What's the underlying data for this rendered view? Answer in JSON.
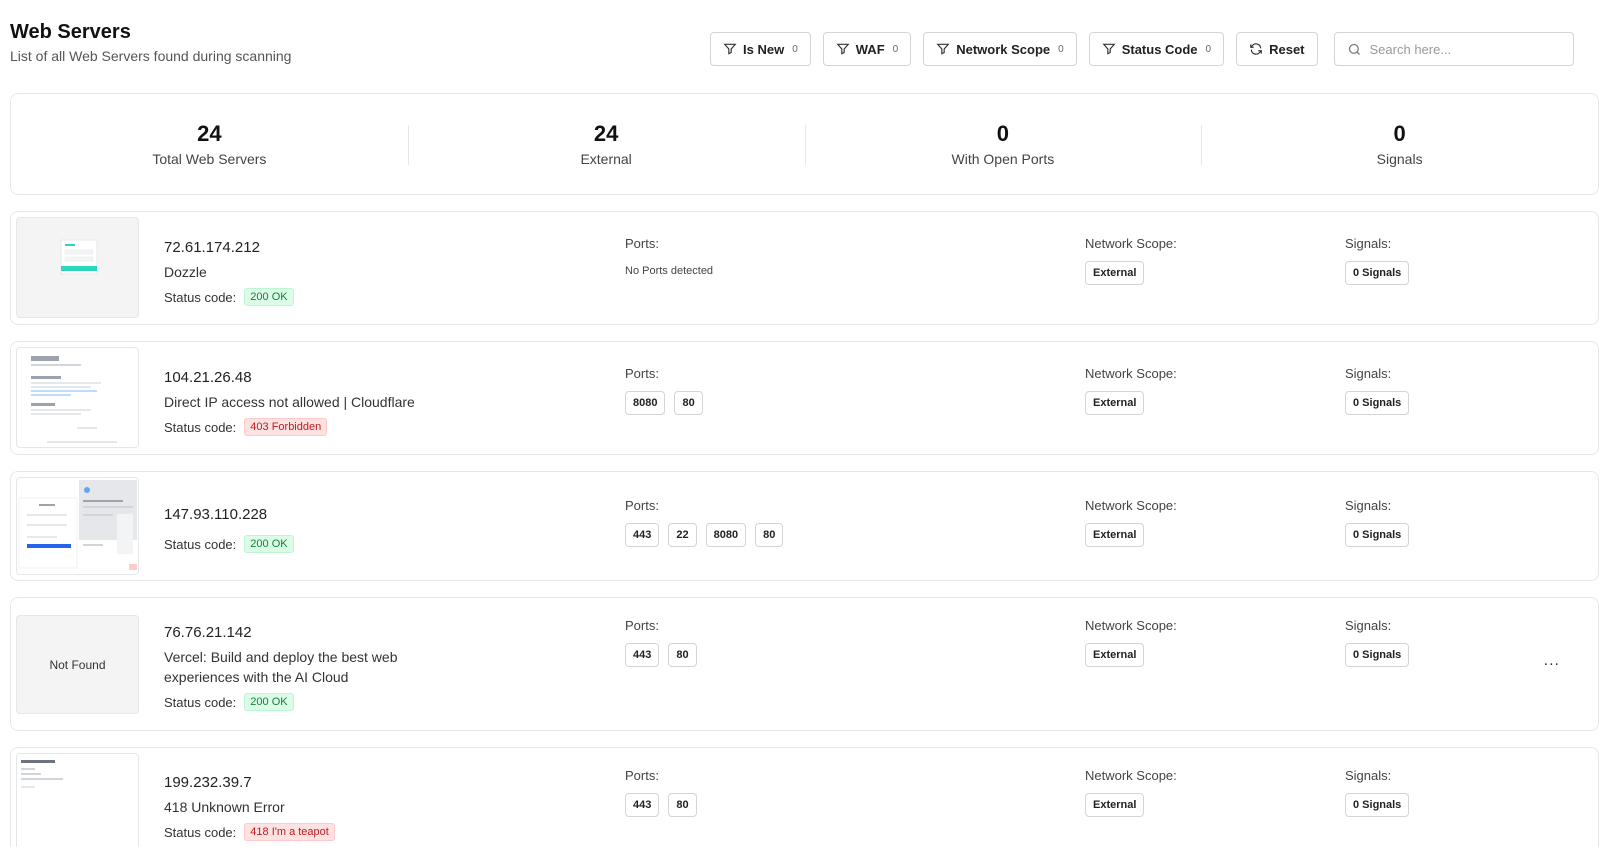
{
  "header": {
    "title": "Web Servers",
    "subtitle": "List of all Web Servers found during scanning"
  },
  "toolbar": {
    "filters": [
      {
        "label": "Is New",
        "count": "0"
      },
      {
        "label": "WAF",
        "count": "0"
      },
      {
        "label": "Network Scope",
        "count": "0"
      },
      {
        "label": "Status Code",
        "count": "0"
      }
    ],
    "reset_label": "Reset",
    "search_placeholder": "Search here..."
  },
  "stats": [
    {
      "value": "24",
      "label": "Total Web Servers"
    },
    {
      "value": "24",
      "label": "External"
    },
    {
      "value": "0",
      "label": "With Open Ports"
    },
    {
      "value": "0",
      "label": "Signals"
    }
  ],
  "labels": {
    "status_code": "Status code:",
    "ports": "Ports:",
    "network_scope": "Network Scope:",
    "signals": "Signals:",
    "more": "..."
  },
  "servers": [
    {
      "ip": "72.61.174.212",
      "name": "Dozzle",
      "status": "200 OK",
      "status_kind": "ok",
      "ports": [],
      "no_ports_text": "No Ports detected",
      "scope": "External",
      "signals": "0 Signals",
      "thumbnail": "login-page"
    },
    {
      "ip": "104.21.26.48",
      "name": "Direct IP access not allowed | Cloudflare",
      "status": "403 Forbidden",
      "status_kind": "err",
      "ports": [
        "8080",
        "80"
      ],
      "scope": "External",
      "signals": "0 Signals",
      "thumbnail": "error-page"
    },
    {
      "ip": "147.93.110.228",
      "name": "",
      "status": "200 OK",
      "status_kind": "ok",
      "ports": [
        "443",
        "22",
        "8080",
        "80"
      ],
      "scope": "External",
      "signals": "0 Signals",
      "thumbnail": "dashboard-page"
    },
    {
      "ip": "76.76.21.142",
      "name": "Vercel: Build and deploy the best web experiences with the AI Cloud",
      "status": "200 OK",
      "status_kind": "ok",
      "ports": [
        "443",
        "80"
      ],
      "scope": "External",
      "signals": "0 Signals",
      "thumbnail_text": "Not Found"
    },
    {
      "ip": "199.232.39.7",
      "name": "418 Unknown Error",
      "status": "418 I'm a teapot",
      "status_kind": "err",
      "ports": [
        "443",
        "80"
      ],
      "scope": "External",
      "signals": "0 Signals",
      "thumbnail": "error-page"
    }
  ]
}
